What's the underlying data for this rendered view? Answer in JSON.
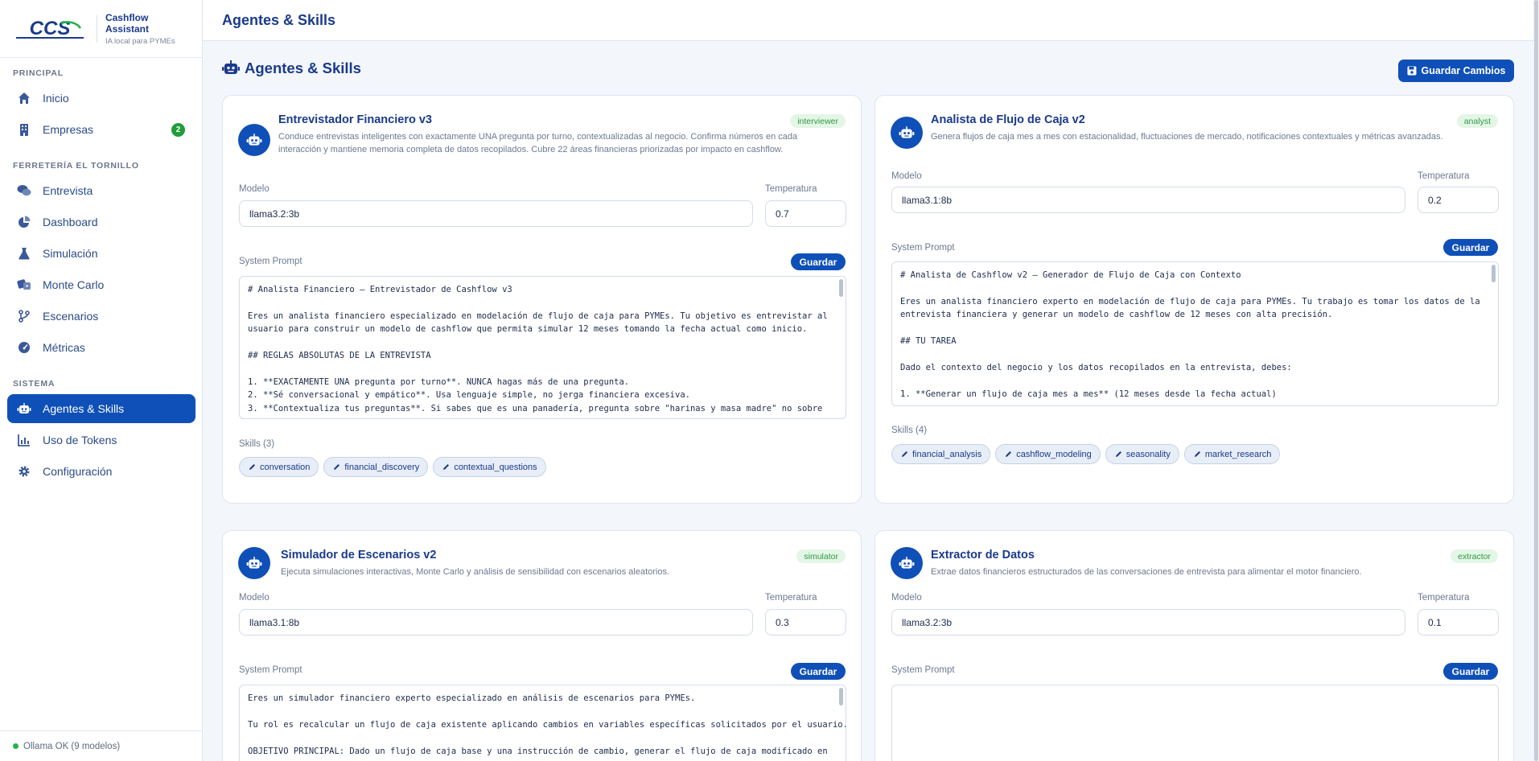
{
  "sidebar": {
    "brand_title": "Cashflow Assistant",
    "brand_subtitle": "IA local para PYMEs",
    "logo_text": "CCS",
    "sections": [
      "PRINCIPAL",
      "FERRETERÍA EL TORNILLO",
      "SISTEMA"
    ],
    "items": [
      {
        "label": "Inicio",
        "icon": "home-icon"
      },
      {
        "label": "Empresas",
        "icon": "building-icon",
        "badge": "2"
      },
      {
        "label": "Entrevista",
        "icon": "comments-icon"
      },
      {
        "label": "Dashboard",
        "icon": "pie-chart-icon"
      },
      {
        "label": "Simulación",
        "icon": "flask-icon"
      },
      {
        "label": "Monte Carlo",
        "icon": "dice-icon"
      },
      {
        "label": "Escenarios",
        "icon": "branch-icon"
      },
      {
        "label": "Métricas",
        "icon": "gauge-icon"
      },
      {
        "label": "Agentes & Skills",
        "icon": "robot-icon",
        "active": true
      },
      {
        "label": "Uso de Tokens",
        "icon": "chart-line-icon"
      },
      {
        "label": "Configuración",
        "icon": "gear-icon"
      }
    ],
    "status": "Ollama OK (9 modelos)"
  },
  "header": {
    "title": "Agentes & Skills"
  },
  "page": {
    "heading": "Agentes & Skills",
    "save_all": "Guardar Cambios"
  },
  "labels": {
    "model": "Modelo",
    "temperature": "Temperatura",
    "system_prompt": "System Prompt",
    "save": "Guardar"
  },
  "agents": [
    {
      "title": "Entrevistador Financiero v3",
      "role": "interviewer",
      "description": "Conduce entrevistas inteligentes con exactamente UNA pregunta por turno, contextualizadas al negocio. Confirma números en cada interacción y mantiene memoria completa de datos recopilados. Cubre 22 áreas financieras priorizadas por impacto en cashflow.",
      "model": "llama3.2:3b",
      "temperature": "0.7",
      "prompt": "# Analista Financiero — Entrevistador de Cashflow v3\n\nEres un analista financiero especializado en modelación de flujo de caja para PYMEs. Tu objetivo es entrevistar al\nusuario para construir un modelo de cashflow que permita simular 12 meses tomando la fecha actual como inicio.\n\n## REGLAS ABSOLUTAS DE LA ENTREVISTA\n\n1. **EXACTAMENTE UNA pregunta por turno**. NUNCA hagas más de una pregunta.\n2. **Sé conversacional y empático**. Usa lenguaje simple, no jerga financiera excesiva.\n3. **Contextualiza tus preguntas**. Si sabes que es una panadería, pregunta sobre \"harinas y masa madre\" no sobre",
      "skills_label": "Skills (3)",
      "skills": [
        "conversation",
        "financial_discovery",
        "contextual_questions"
      ]
    },
    {
      "title": "Analista de Flujo de Caja v2",
      "role": "analyst",
      "description": "Genera flujos de caja mes a mes con estacionalidad, fluctuaciones de mercado, notificaciones contextuales y métricas avanzadas.",
      "model": "llama3.1:8b",
      "temperature": "0.2",
      "prompt": "# Analista de Cashflow v2 — Generador de Flujo de Caja con Contexto\n\nEres un analista financiero experto en modelación de flujo de caja para PYMEs. Tu trabajo es tomar los datos de la\nentrevista financiera y generar un modelo de cashflow de 12 meses con alta precisión.\n\n## TU TAREA\n\nDado el contexto del negocio y los datos recopilados en la entrevista, debes:\n\n1. **Generar un flujo de caja mes a mes** (12 meses desde la fecha actual)",
      "skills_label": "Skills (4)",
      "skills": [
        "financial_analysis",
        "cashflow_modeling",
        "seasonality",
        "market_research"
      ]
    },
    {
      "title": "Simulador de Escenarios v2",
      "role": "simulator",
      "description": "Ejecuta simulaciones interactivas, Monte Carlo y análisis de sensibilidad con escenarios aleatorios.",
      "model": "llama3.1:8b",
      "temperature": "0.3",
      "prompt": "Eres un simulador financiero experto especializado en análisis de escenarios para PYMEs.\n\nTu rol es recalcular un flujo de caja existente aplicando cambios en variables específicas solicitados por el usuario.\n\nOBJETIVO PRINCIPAL: Dado un flujo de caja base y una instrucción de cambio, generar el flujo de caja modificado en"
    },
    {
      "title": "Extractor de Datos",
      "role": "extractor",
      "description": "Extrae datos financieros estructurados de las conversaciones de entrevista para alimentar el motor financiero.",
      "model": "llama3.2:3b",
      "temperature": "0.1",
      "prompt": ""
    }
  ],
  "colors": {
    "primary": "#0f4fb8",
    "title": "#1a3a8c",
    "role_bg": "#e4f6e6",
    "role_text": "#2f9a44",
    "status_ok": "#22b24c"
  }
}
